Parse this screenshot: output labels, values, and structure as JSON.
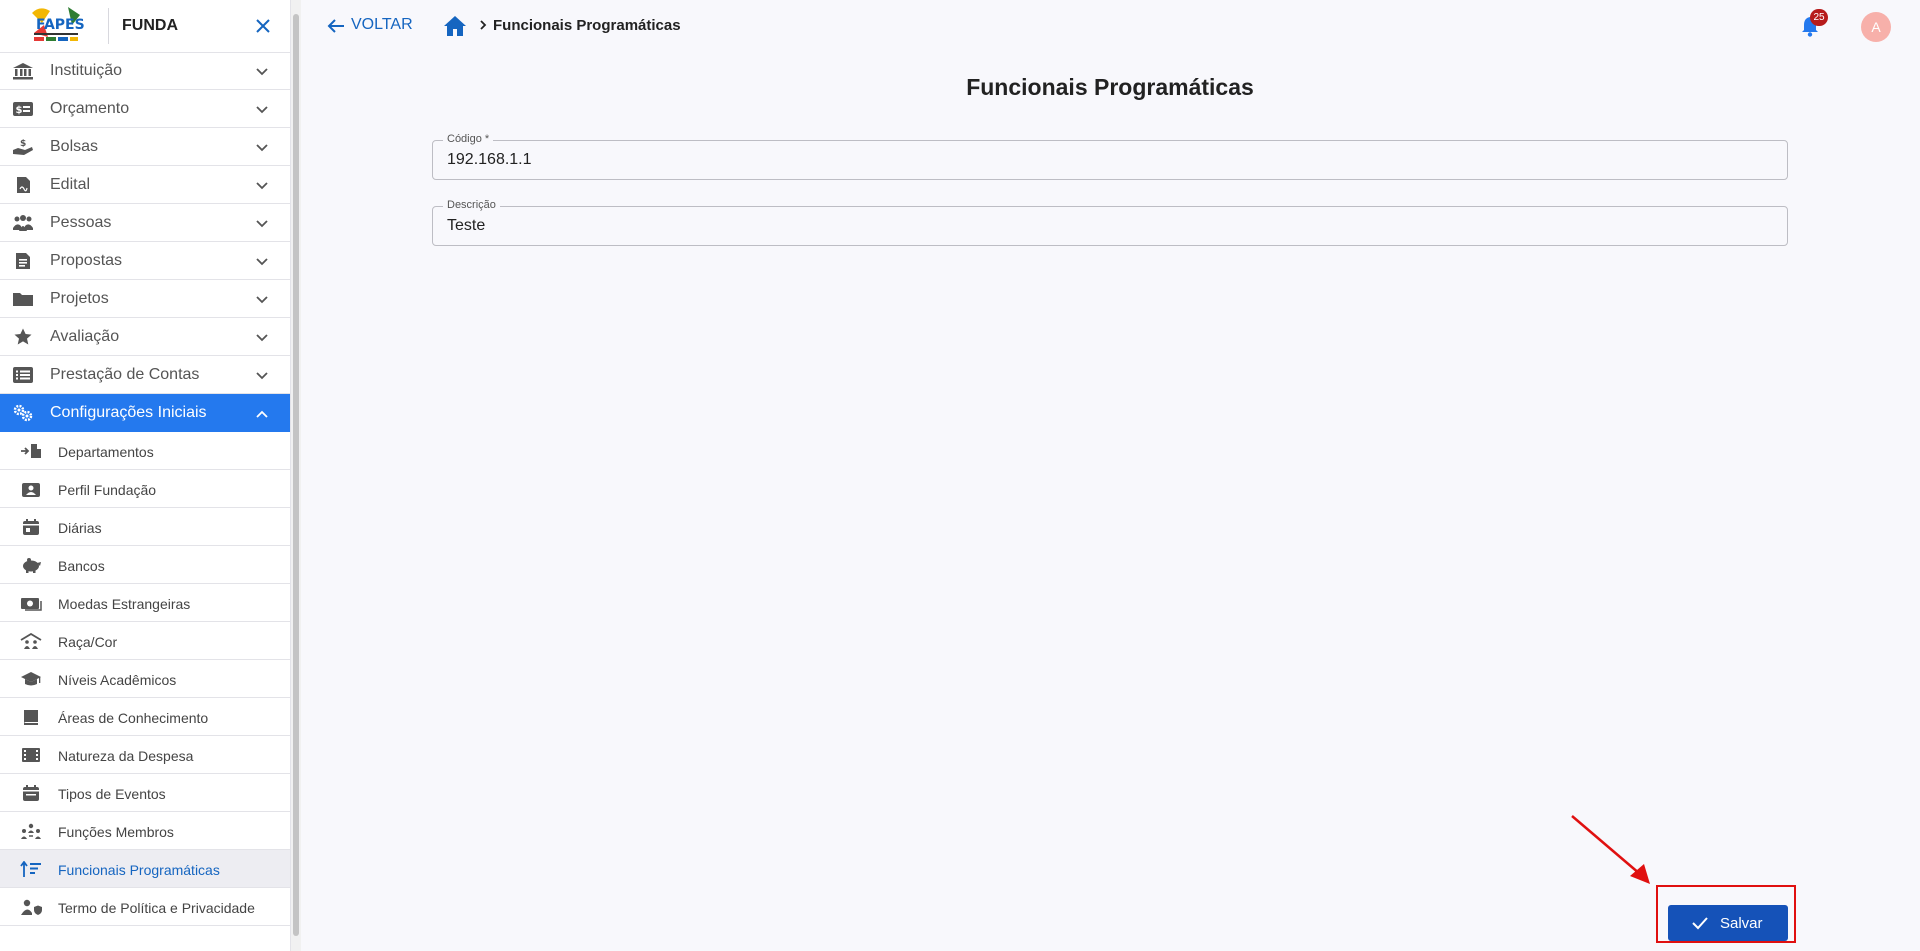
{
  "app": {
    "name": "FUNDA",
    "logo_alt": "FAPES"
  },
  "sidebar": {
    "items": [
      {
        "label": "Instituição",
        "icon": "bank-icon"
      },
      {
        "label": "Orçamento",
        "icon": "money-card-icon"
      },
      {
        "label": "Bolsas",
        "icon": "hand-coin-icon"
      },
      {
        "label": "Edital",
        "icon": "document-signature-icon"
      },
      {
        "label": "Pessoas",
        "icon": "people-icon"
      },
      {
        "label": "Propostas",
        "icon": "file-text-icon"
      },
      {
        "label": "Projetos",
        "icon": "folder-icon"
      },
      {
        "label": "Avaliação",
        "icon": "star-icon"
      },
      {
        "label": "Prestação de Contas",
        "icon": "list-icon"
      },
      {
        "label": "Configurações Iniciais",
        "icon": "gears-icon",
        "active": true
      }
    ],
    "subitems": [
      {
        "label": "Departamentos",
        "icon": "building-arrow-icon"
      },
      {
        "label": "Perfil Fundação",
        "icon": "id-badge-icon"
      },
      {
        "label": "Diárias",
        "icon": "calendar-icon"
      },
      {
        "label": "Bancos",
        "icon": "piggy-bank-icon"
      },
      {
        "label": "Moedas Estrangeiras",
        "icon": "money-bill-icon"
      },
      {
        "label": "Raça/Cor",
        "icon": "people-roof-icon"
      },
      {
        "label": "Níveis Acadêmicos",
        "icon": "graduation-cap-icon"
      },
      {
        "label": "Áreas de Conhecimento",
        "icon": "book-icon"
      },
      {
        "label": "Natureza da Despesa",
        "icon": "film-icon"
      },
      {
        "label": "Tipos de Eventos",
        "icon": "calendar-event-icon"
      },
      {
        "label": "Funções Membros",
        "icon": "people-group-icon"
      },
      {
        "label": "Funcionais Programáticas",
        "icon": "sort-amount-icon",
        "current": true
      },
      {
        "label": "Termo de Política e Privacidade",
        "icon": "user-shield-icon"
      }
    ]
  },
  "topbar": {
    "back_label": "VOLTAR",
    "breadcrumb_current": "Funcionais Programáticas",
    "notification_count": "25",
    "avatar_initial": "A"
  },
  "main": {
    "title": "Funcionais Programáticas",
    "fields": {
      "codigo": {
        "label": "Código *",
        "value": "192.168.1.1"
      },
      "descricao": {
        "label": "Descrição",
        "value": "Teste"
      }
    },
    "save_label": "Salvar"
  },
  "colors": {
    "primary": "#1565c0",
    "active_nav": "#2479ee",
    "save_button": "#1552b8",
    "highlight": "#e01010",
    "badge": "#b71c1c"
  }
}
